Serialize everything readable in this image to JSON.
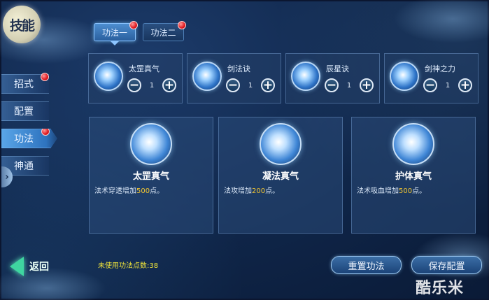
{
  "emblem": {
    "text": "技能"
  },
  "tabs": [
    {
      "label": "功法一",
      "active": true,
      "badge": true
    },
    {
      "label": "功法二",
      "active": false,
      "badge": true
    }
  ],
  "sidebar": {
    "items": [
      {
        "label": "招式",
        "active": false,
        "badge": true
      },
      {
        "label": "配置",
        "active": false,
        "badge": false
      },
      {
        "label": "功法",
        "active": true,
        "badge": true
      },
      {
        "label": "神通",
        "active": false,
        "badge": false
      }
    ],
    "toggle": "›"
  },
  "skills": [
    {
      "name": "太罡真气",
      "count": "1",
      "minus": "−",
      "plus": "+"
    },
    {
      "name": "剑法诀",
      "count": "1",
      "minus": "−",
      "plus": "+"
    },
    {
      "name": "辰星诀",
      "count": "1",
      "minus": "−",
      "plus": "+"
    },
    {
      "name": "剑神之力",
      "count": "1",
      "minus": "−",
      "plus": "+"
    }
  ],
  "bonuses": [
    {
      "title": "太罡真气",
      "desc_prefix": "法术穿透增加",
      "value": "500",
      "desc_suffix": "点。"
    },
    {
      "title": "凝法真气",
      "desc_prefix": "法攻增加",
      "value": "200",
      "desc_suffix": "点。"
    },
    {
      "title": "护体真气",
      "desc_prefix": "法术吸血增加",
      "value": "500",
      "desc_suffix": "点。"
    }
  ],
  "footer": {
    "back_label": "返回",
    "unused_points": "未使用功法点数:38",
    "reset_label": "重置功法",
    "save_label": "保存配置"
  },
  "watermark": "酷乐米",
  "colors": {
    "accent": "#5aa6e8",
    "badge": "#e0161d",
    "highlight": "#f2c631",
    "points": "#f0e43a"
  }
}
